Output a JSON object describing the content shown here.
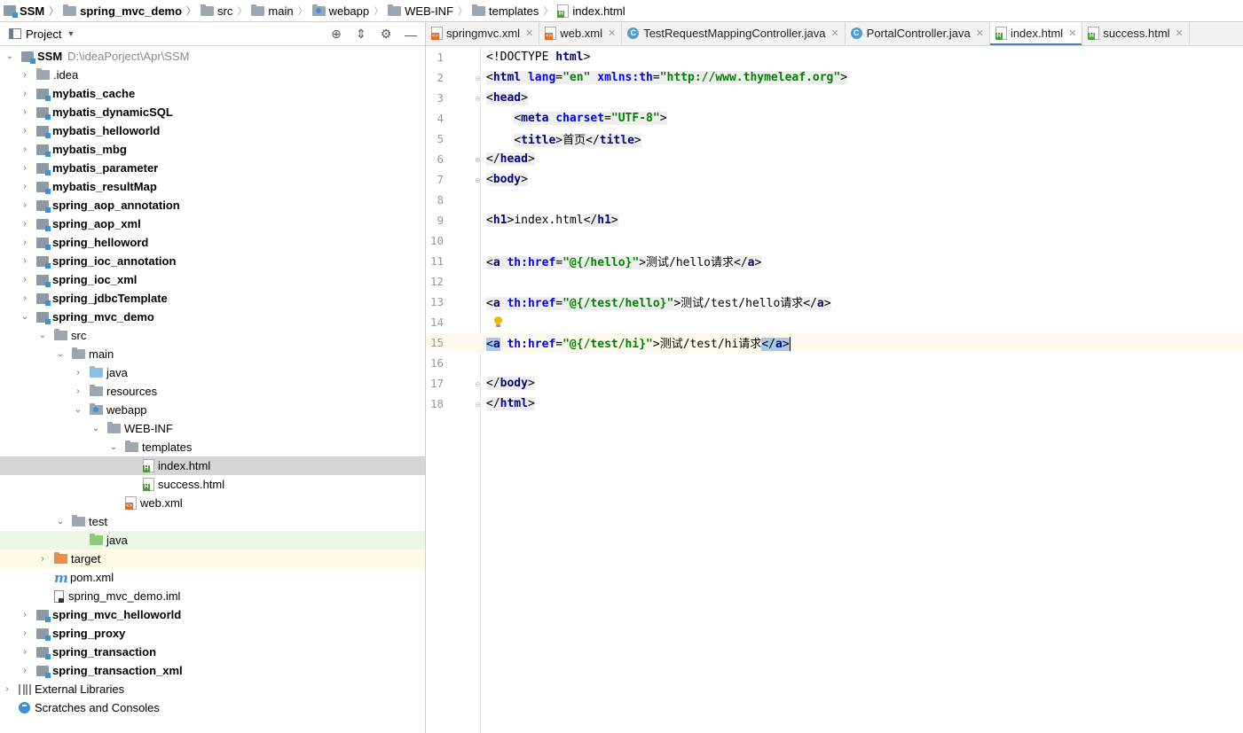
{
  "breadcrumb": {
    "items": [
      "SSM",
      "spring_mvc_demo",
      "src",
      "main",
      "webapp",
      "WEB-INF",
      "templates",
      "index.html"
    ]
  },
  "project_panel": {
    "title": "Project",
    "tree": [
      {
        "label": "SSM",
        "path": "D:\\ideaPorject\\Apr\\SSM"
      },
      {
        "label": ".idea"
      },
      {
        "label": "mybatis_cache"
      },
      {
        "label": "mybatis_dynamicSQL"
      },
      {
        "label": "mybatis_helloworld"
      },
      {
        "label": "mybatis_mbg"
      },
      {
        "label": "mybatis_parameter"
      },
      {
        "label": "mybatis_resultMap"
      },
      {
        "label": "spring_aop_annotation"
      },
      {
        "label": "spring_aop_xml"
      },
      {
        "label": "spring_helloword"
      },
      {
        "label": "spring_ioc_annotation"
      },
      {
        "label": "spring_ioc_xml"
      },
      {
        "label": "spring_jdbcTemplate"
      },
      {
        "label": "spring_mvc_demo"
      },
      {
        "label": "src"
      },
      {
        "label": "main"
      },
      {
        "label": "java"
      },
      {
        "label": "resources"
      },
      {
        "label": "webapp"
      },
      {
        "label": "WEB-INF"
      },
      {
        "label": "templates"
      },
      {
        "label": "index.html"
      },
      {
        "label": "success.html"
      },
      {
        "label": "web.xml"
      },
      {
        "label": "test"
      },
      {
        "label": "java"
      },
      {
        "label": "target"
      },
      {
        "label": "pom.xml"
      },
      {
        "label": "spring_mvc_demo.iml"
      },
      {
        "label": "spring_mvc_helloworld"
      },
      {
        "label": "spring_proxy"
      },
      {
        "label": "spring_transaction"
      },
      {
        "label": "spring_transaction_xml"
      },
      {
        "label": "External Libraries"
      },
      {
        "label": "Scratches and Consoles"
      }
    ]
  },
  "tabs": [
    {
      "label": "springmvc.xml",
      "icon": "xml-file-icon"
    },
    {
      "label": "web.xml",
      "icon": "xml-file-icon"
    },
    {
      "label": "TestRequestMappingController.java",
      "icon": "class-icon"
    },
    {
      "label": "PortalController.java",
      "icon": "class-icon"
    },
    {
      "label": "index.html",
      "icon": "html-file-icon",
      "active": true
    },
    {
      "label": "success.html",
      "icon": "html-file-icon"
    }
  ],
  "editor": {
    "line_numbers": [
      "1",
      "2",
      "3",
      "4",
      "5",
      "6",
      "7",
      "8",
      "9",
      "10",
      "11",
      "12",
      "13",
      "14",
      "15",
      "16",
      "17",
      "18"
    ],
    "current_line": 15,
    "code": {
      "l1_doctype": "<!DOCTYPE ",
      "l1_html": "html",
      "l1_close": ">",
      "l2_open": "<",
      "l2_tag": "html",
      "l2_attr1": "lang",
      "l2_val1": "\"en\"",
      "l2_attr2": "xmlns:th",
      "l2_val2": "\"http://www.thymeleaf.org\"",
      "l3_tag": "head",
      "l4_tag": "meta",
      "l4_attr": "charset",
      "l4_val": "\"UTF-8\"",
      "l5_tag": "title",
      "l5_text": "首页",
      "l6_tag": "head",
      "l7_tag": "body",
      "l9_tag": "h1",
      "l9_text": "index.html",
      "l11_attr": "th:href",
      "l11_val": "\"@{/hello}\"",
      "l11_text": "测试/hello请求",
      "l13_val": "\"@{/test/hello}\"",
      "l13_text": "测试/test/hello请求",
      "l15_val": "\"@{/test/hi}\"",
      "l15_text": "测试/test/hi请求",
      "a_tag": "a",
      "l17_tag": "body",
      "l18_tag": "html"
    }
  }
}
